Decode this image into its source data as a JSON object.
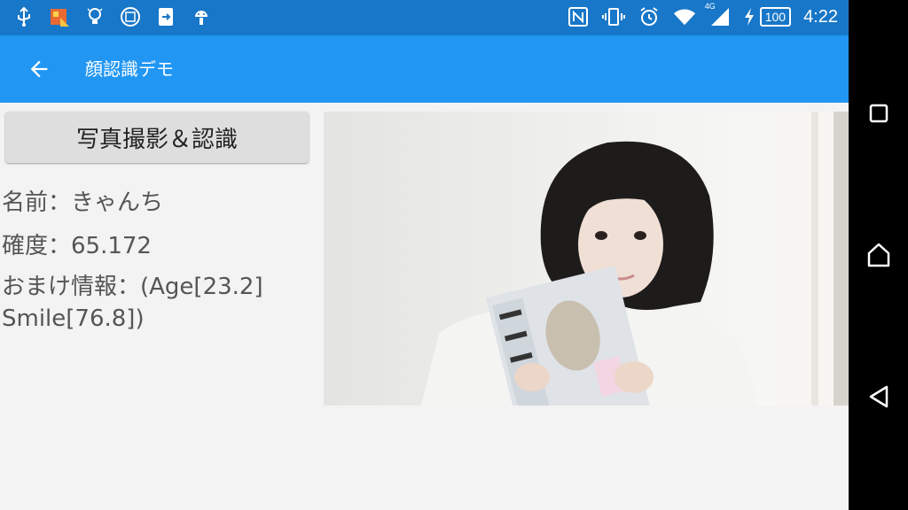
{
  "status_bar": {
    "time": "4:22",
    "battery_level": "100",
    "network_type": "4G",
    "left_icons": [
      "usb-icon",
      "game-notification-icon",
      "lightbulb-icon",
      "calendar-icon",
      "file-transfer-icon",
      "android-icon"
    ],
    "right_icons": [
      "nfc-icon",
      "vibrate-icon",
      "alarm-icon",
      "wifi-icon",
      "cell-signal-icon",
      "battery-charging-icon"
    ]
  },
  "app_bar": {
    "title": "顔認識デモ"
  },
  "main": {
    "capture_button_label": "写真撮影＆認識",
    "name_line": "名前：きゃんち",
    "confidence_line": "確度：65.172",
    "extra_info_line": "おまけ情報：(Age[23.2] Smile[76.8])"
  },
  "colors": {
    "status_bar": "#1877c8",
    "app_bar": "#2196f3",
    "background": "#f3f3f3",
    "button": "#dedede"
  }
}
